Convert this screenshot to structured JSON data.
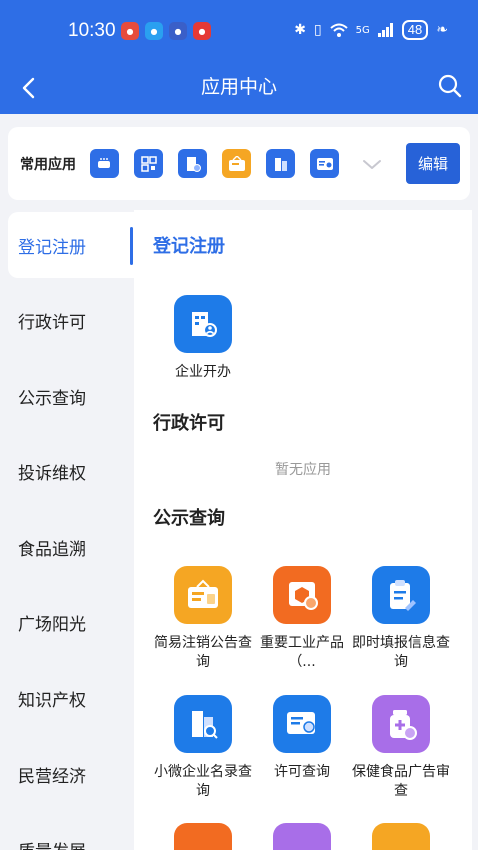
{
  "status": {
    "time": "10:30",
    "network": "5G",
    "battery": "48"
  },
  "header": {
    "title": "应用中心"
  },
  "favorites": {
    "label": "常用应用",
    "edit_label": "编辑",
    "icon_color": "#2e6ee6",
    "accent_color": "#f5a623"
  },
  "sidebar": {
    "items": [
      "登记注册",
      "行政许可",
      "公示查询",
      "投诉维权",
      "食品追溯",
      "广场阳光",
      "知识产权",
      "民营经济",
      "质量发展"
    ]
  },
  "content": {
    "sections": [
      {
        "title": "登记注册",
        "apps": [
          {
            "label": "企业开办",
            "icon": "building-person-icon",
            "color": "#1e7be8"
          }
        ]
      },
      {
        "title": "行政许可",
        "empty_text": "暂无应用"
      },
      {
        "title": "公示查询",
        "apps": [
          {
            "label": "简易注销公告查询",
            "icon": "notice-board-icon",
            "color": "#f5a623"
          },
          {
            "label": "重要工业产品（...",
            "icon": "product-box-icon",
            "color": "#f26b21"
          },
          {
            "label": "即时填报信息查询",
            "icon": "clipboard-edit-icon",
            "color": "#1e7be8"
          },
          {
            "label": "小微企业名录查询",
            "icon": "building-search-icon",
            "color": "#1e7be8"
          },
          {
            "label": "许可查询",
            "icon": "license-card-icon",
            "color": "#1e7be8"
          },
          {
            "label": "保健食品广告审查",
            "icon": "health-food-icon",
            "color": "#a86ee8"
          }
        ]
      }
    ]
  }
}
